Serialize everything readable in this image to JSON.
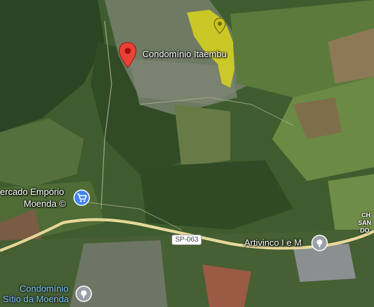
{
  "places": {
    "condominio_itaembu": "Condomínio Itaembu",
    "mercado_label_line1": "ercado Empório",
    "mercado_label_line2": "Moenda ©",
    "artivinco": "Artivinco I e M",
    "sitio_line1": "Condomínio",
    "sitio_line2": "Sítio da Moenda",
    "edge_line1": "CH",
    "edge_line2": "SAN",
    "edge_line3": "DO"
  },
  "road": {
    "shield": "SP-063"
  },
  "icons": {
    "selected_pin": "red-location-pin-icon",
    "park_pin": "yellow-park-pin-icon",
    "shop_pin": "shopping-cart-icon",
    "generic_pin": "gray-place-pin-icon"
  },
  "colors": {
    "selected_pin": "#ea4335",
    "park_highlight": "#d9d61c",
    "shop_pin": "#4285f4",
    "generic_pin": "#9aa0a6",
    "road": "#f3e3a6"
  }
}
